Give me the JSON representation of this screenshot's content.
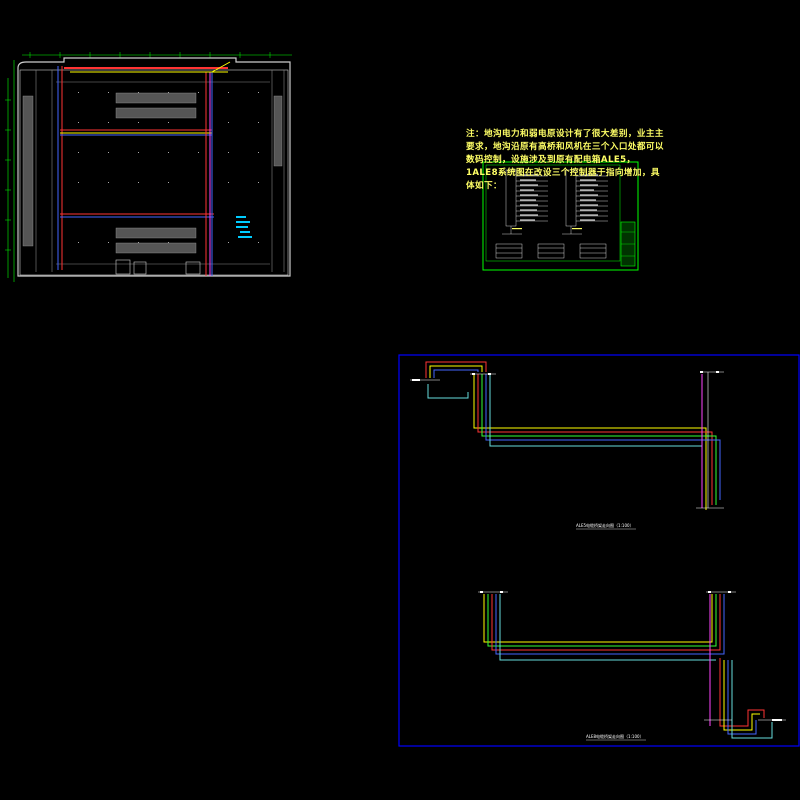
{
  "note": {
    "text": "注：地沟电力和弱电原设计有了很大差别，业主主要求，地沟沿原有高桥和风机在三个入口处都可以数码控制，设施涉及到原有配电箱ALE5，1ALE8系统图在改设三个控制器于指向增加，具体如下："
  },
  "drawings": {
    "floor_plan": "floor-plan",
    "system_sheet": "system-diagram-sheet",
    "routing_sheet": "cable-routing-sheet"
  },
  "captions": {
    "upper_route": "ALE5电缆桥架走向图（1:100）",
    "lower_route": "ALE8电缆桥架走向图（1:100）"
  },
  "colors": {
    "background": "#000000",
    "sheet_frame": "#0000ff",
    "green_frame": "#00ff00",
    "note_text": "#ffff66",
    "route_red": "#ff3333",
    "route_yellow": "#ffff00",
    "route_green": "#33ff33",
    "route_blue": "#4466ff",
    "route_magenta": "#ff44ff",
    "route_cyan": "#66dddd",
    "wall": "#cccccc"
  }
}
